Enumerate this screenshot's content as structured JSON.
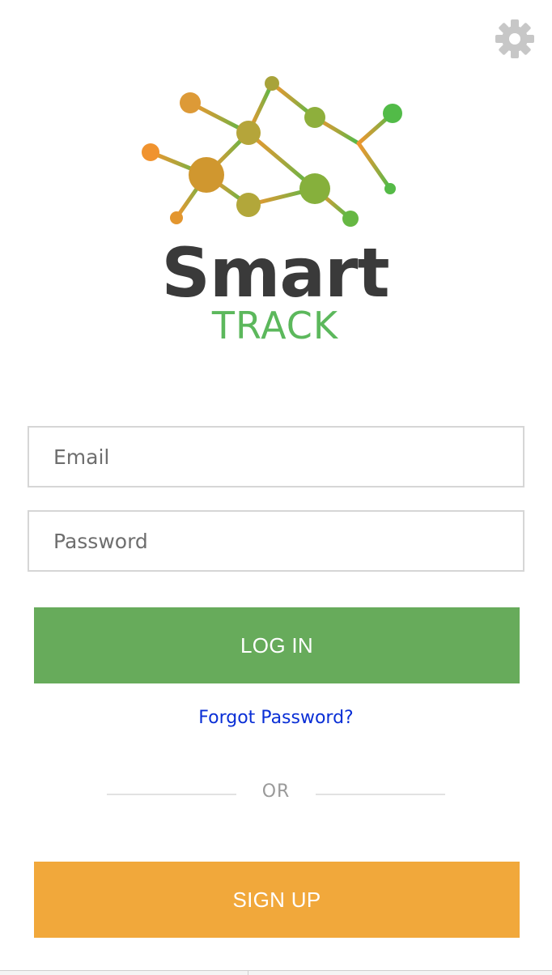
{
  "header": {
    "settings_icon": "gear-icon",
    "settings_color": "#c7c7c7"
  },
  "logo": {
    "title": "Smart",
    "subtitle": "TRACK",
    "title_color": "#3a3a3a",
    "subtitle_color": "#5cb85c",
    "gradient_start": "#f0962f",
    "gradient_end": "#4cbb4a"
  },
  "form": {
    "email_placeholder": "Email",
    "email_value": "",
    "password_placeholder": "Password",
    "password_value": ""
  },
  "actions": {
    "login_label": "LOG IN",
    "login_color": "#67ab5b",
    "forgot_label": "Forgot Password?",
    "forgot_color": "#0a2fd6",
    "divider_label": "OR",
    "signup_label": "SIGN UP",
    "signup_color": "#f1a83b"
  }
}
